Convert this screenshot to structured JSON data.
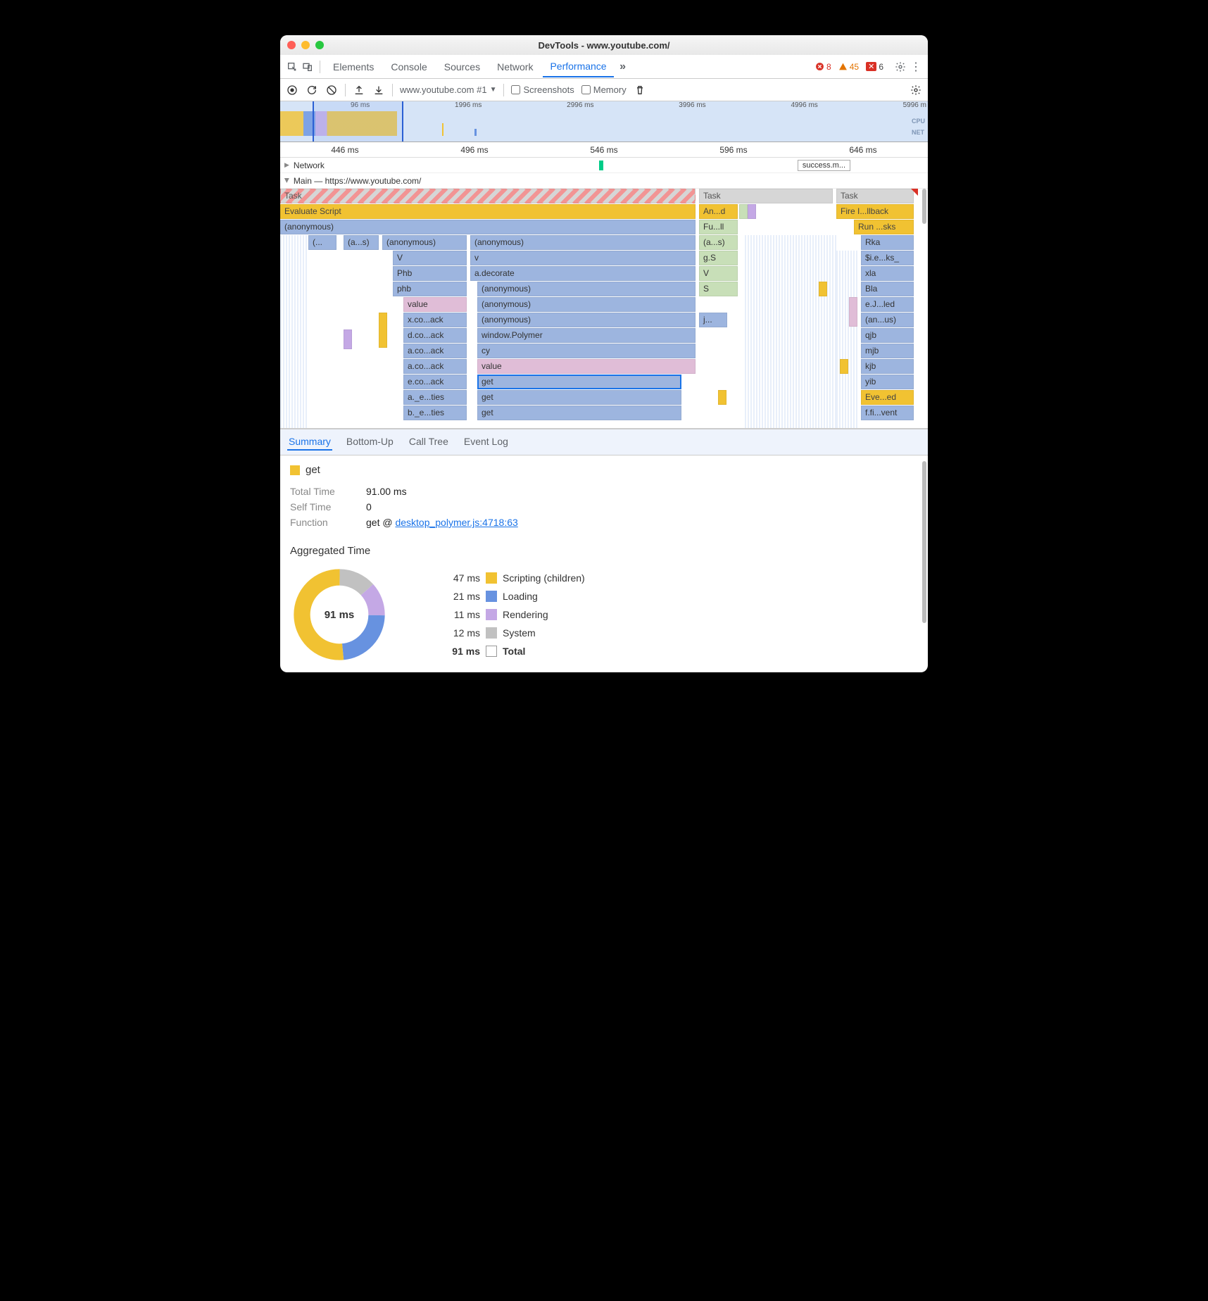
{
  "window": {
    "title": "DevTools - www.youtube.com/"
  },
  "mainTabs": [
    "Elements",
    "Console",
    "Sources",
    "Network",
    "Performance"
  ],
  "activeMainTab": "Performance",
  "issues": {
    "error_count": "8",
    "warn_count": "45",
    "crit_count": "6"
  },
  "toolbar": {
    "profile_name": "www.youtube.com #1",
    "screenshots_label": "Screenshots",
    "memory_label": "Memory"
  },
  "overview": {
    "ticks": [
      "96 ms",
      "1996 ms",
      "2996 ms",
      "3996 ms",
      "4996 ms",
      "5996 m"
    ],
    "labels": [
      "CPU",
      "NET"
    ]
  },
  "ruler": [
    "446 ms",
    "496 ms",
    "546 ms",
    "596 ms",
    "646 ms"
  ],
  "network_track_label": "Network",
  "main_track_label": "Main — https://www.youtube.com/",
  "success_chip": "success.m...",
  "flame": {
    "col1": {
      "task": "Task",
      "eval": "Evaluate Script",
      "anon": "(anonymous)",
      "r3a": "(...",
      "r3b": "(a...s)",
      "r3c": "(anonymous)",
      "r3d": "(anonymous)",
      "c1_4": "V",
      "d4": "v",
      "c1_5": "Phb",
      "d5": "a.decorate",
      "c1_6": "phb",
      "d6": "(anonymous)",
      "c1_7": "value",
      "d7": "(anonymous)",
      "c1_8": "x.co...ack",
      "d8": "(anonymous)",
      "c1_9": "d.co...ack",
      "d9": "window.Polymer",
      "c1_10": "a.co...ack",
      "d10": "cy",
      "c1_11": "a.co...ack",
      "d11": "value",
      "c1_12": "e.co...ack",
      "d12": "get",
      "c1_13": "a._e...ties",
      "d13": "get",
      "c1_14": "b._e...ties",
      "d14": "get"
    },
    "col2": {
      "task": "Task",
      "an": "An...d",
      "fu": "Fu...ll",
      "r3": "(a...s)",
      "r4": "g.S",
      "r5": "V",
      "r6": "S",
      "r8": "j..."
    },
    "col3": {
      "task": "Task",
      "fire": "Fire I...llback",
      "run": "Run ...sks",
      "r3": "Rka",
      "r4": "$i.e...ks_",
      "r5": "xla",
      "r6": "Bla",
      "r7": "e.J...led",
      "r8": "(an...us)",
      "r9": "qjb",
      "r10": "mjb",
      "r11": "kjb",
      "r12": "yib",
      "r13": "Eve...ed",
      "r14": "f.fi...vent"
    }
  },
  "detailTabs": [
    "Summary",
    "Bottom-Up",
    "Call Tree",
    "Event Log"
  ],
  "activeDetailTab": "Summary",
  "summary": {
    "name": "get",
    "total_time_label": "Total Time",
    "total_time": "91.00 ms",
    "self_time_label": "Self Time",
    "self_time": "0",
    "function_label": "Function",
    "function_prefix": "get @ ",
    "function_link": "desktop_polymer.js:4718:63",
    "agg_title": "Aggregated Time",
    "donut_center": "91 ms",
    "legend": [
      {
        "ms": "47 ms",
        "sw": "#f1c232",
        "label": "Scripting (children)"
      },
      {
        "ms": "21 ms",
        "sw": "#6792e0",
        "label": "Loading"
      },
      {
        "ms": "11 ms",
        "sw": "#c4a8e5",
        "label": "Rendering"
      },
      {
        "ms": "12 ms",
        "sw": "#c1c1c1",
        "label": "System"
      },
      {
        "ms": "91 ms",
        "sw": "outline",
        "label": "Total",
        "bold": true
      }
    ]
  },
  "chart_data": {
    "type": "pie",
    "title": "Aggregated Time",
    "series": [
      {
        "name": "get",
        "values": [
          47,
          21,
          11,
          12
        ]
      }
    ],
    "categories": [
      "Scripting (children)",
      "Loading",
      "Rendering",
      "System"
    ],
    "total": 91,
    "unit": "ms",
    "colors": {
      "Scripting (children)": "#f1c232",
      "Loading": "#6792e0",
      "Rendering": "#c4a8e5",
      "System": "#c1c1c1"
    }
  }
}
